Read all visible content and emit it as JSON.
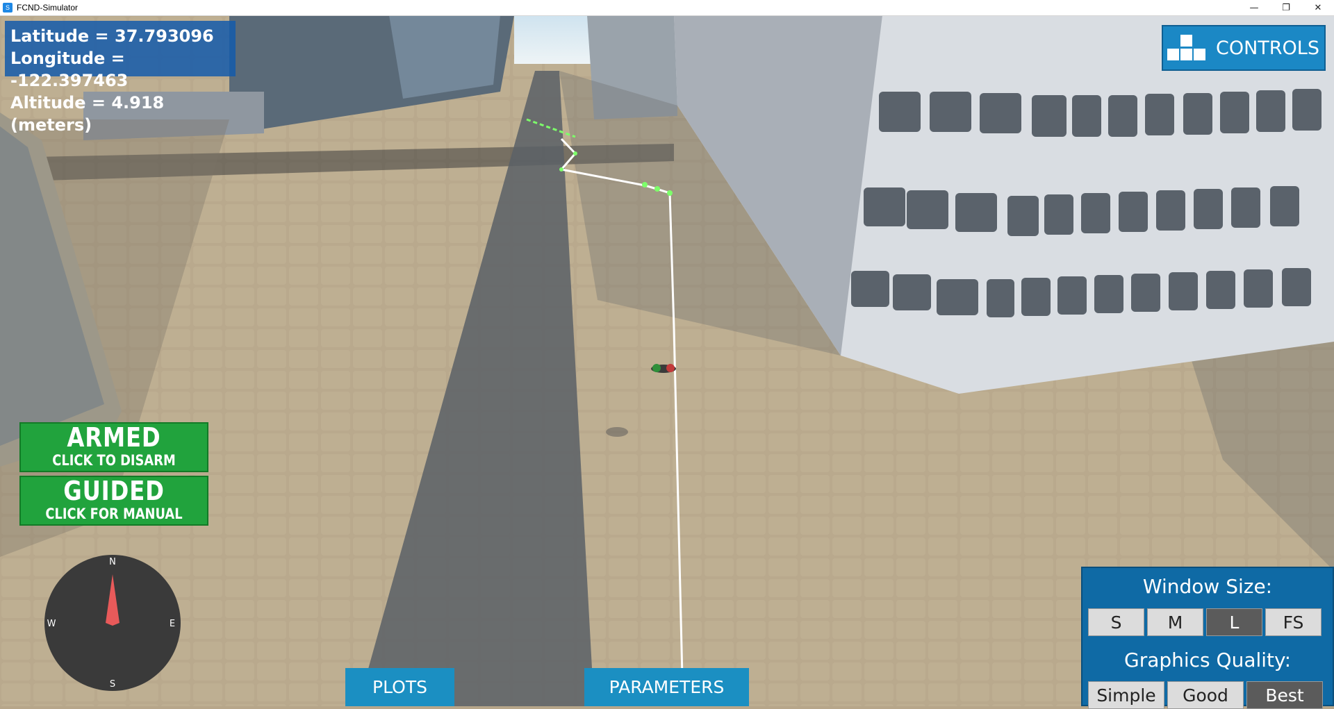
{
  "window": {
    "title": "FCND-Simulator",
    "minimize": "—",
    "restore": "❐",
    "close": "✕"
  },
  "telemetry": {
    "latitude": "Latitude = 37.793096",
    "longitude": "Longitude = -122.397463",
    "altitude": "Altitude = 4.918 (meters)"
  },
  "controls_button": {
    "label": "CONTROLS"
  },
  "armed_button": {
    "state": "ARMED",
    "action": "CLICK TO DISARM"
  },
  "guided_button": {
    "state": "GUIDED",
    "action": "CLICK FOR MANUAL"
  },
  "compass": {
    "n": "N",
    "e": "E",
    "s": "S",
    "w": "W"
  },
  "bottom": {
    "plots": "PLOTS",
    "parameters": "PARAMETERS"
  },
  "settings": {
    "window_size_label": "Window Size:",
    "window_sizes": [
      "S",
      "M",
      "L",
      "FS"
    ],
    "window_size_selected": "L",
    "graphics_label": "Graphics Quality:",
    "graphics_options": [
      "Simple",
      "Good",
      "Best"
    ],
    "graphics_selected": "Best"
  },
  "colors": {
    "hud_blue": "#145aaa",
    "armed_green": "#21a33d",
    "button_blue": "#1b8fc2",
    "path": "#ffffff",
    "waypoint": "#7dff6a"
  }
}
